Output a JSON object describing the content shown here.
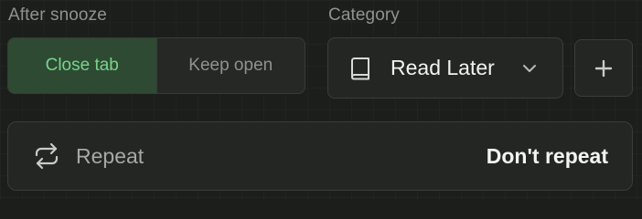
{
  "after_snooze": {
    "label": "After snooze",
    "options": [
      "Close tab",
      "Keep open"
    ],
    "selected": "Close tab"
  },
  "category": {
    "label": "Category",
    "value": "Read Later",
    "icon": "book-icon",
    "add_icon": "plus-icon"
  },
  "repeat": {
    "icon": "repeat-icon",
    "label": "Repeat",
    "value": "Don't repeat"
  },
  "colors": {
    "accent": "#77d58b",
    "accent_bg": "#2e4a33",
    "background": "#1c1e1c",
    "surface": "#242624"
  }
}
